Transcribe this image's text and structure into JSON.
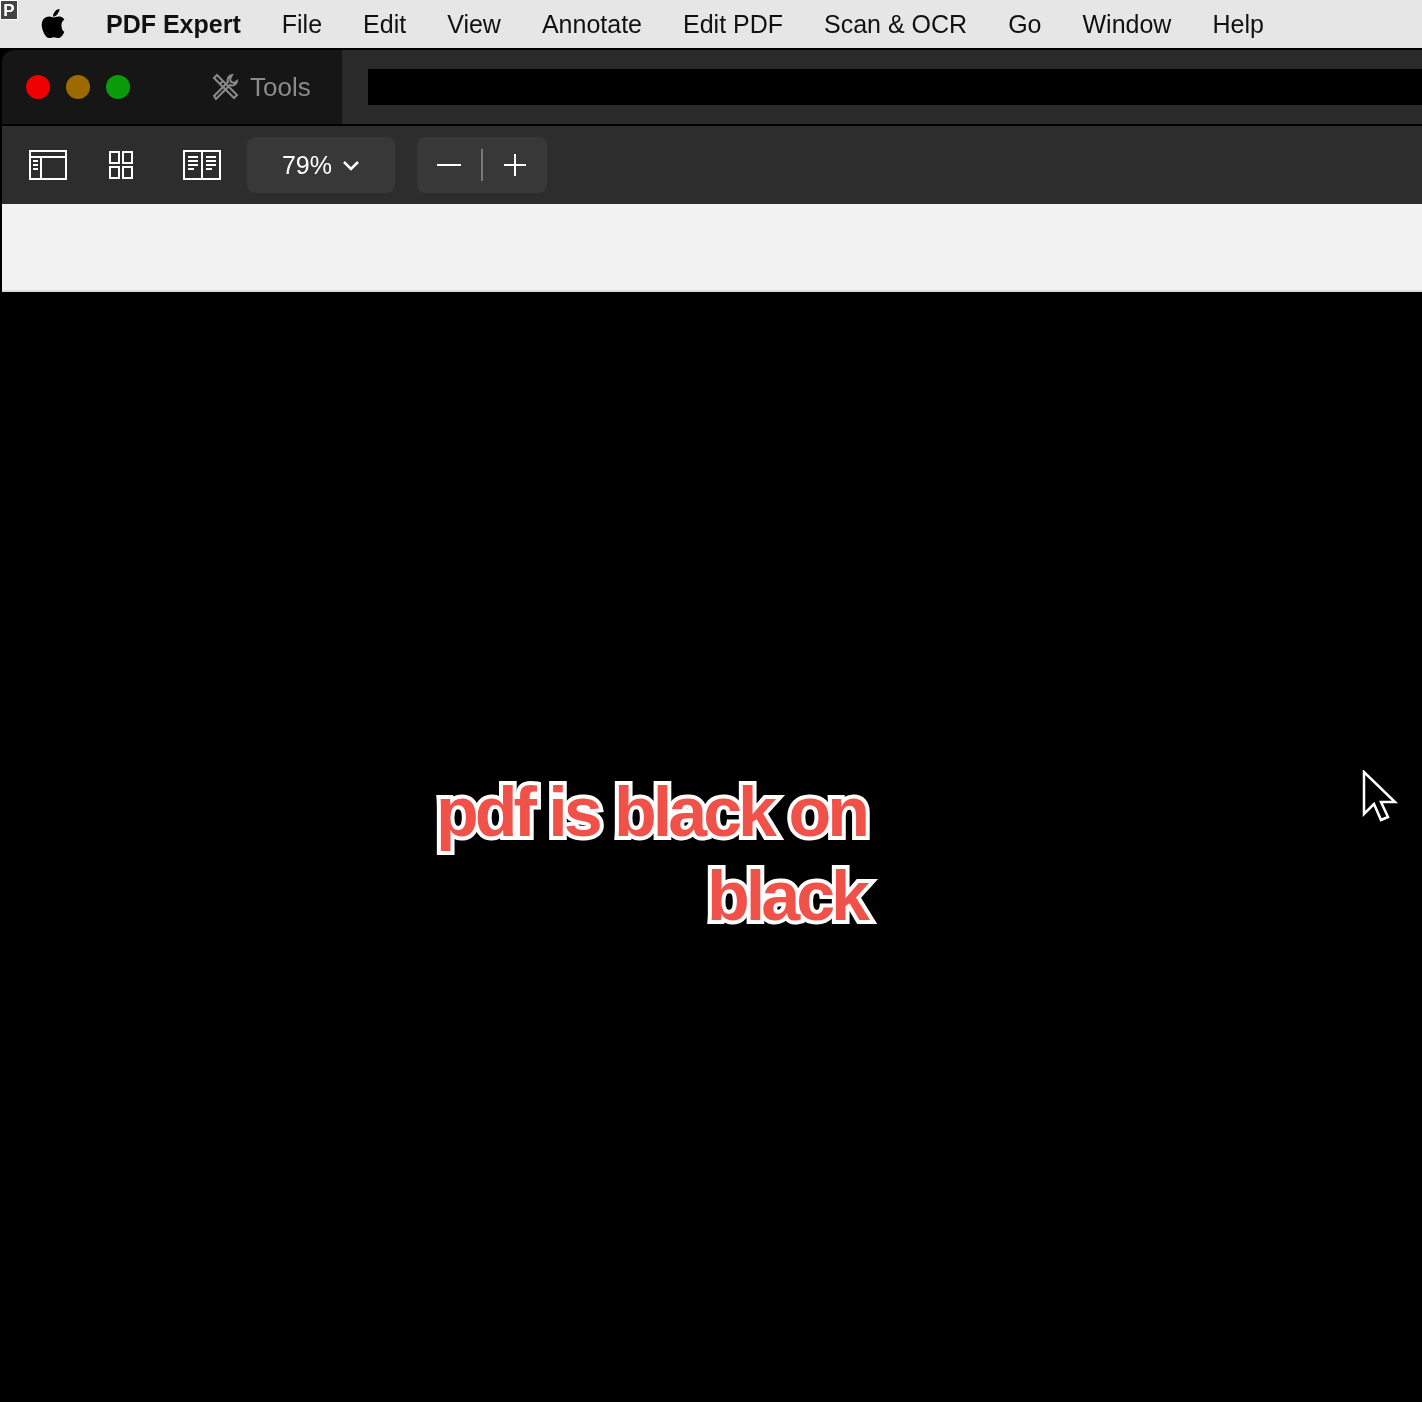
{
  "menu_bar": {
    "app_name": "PDF Expert",
    "items": [
      "File",
      "Edit",
      "View",
      "Annotate",
      "Edit PDF",
      "Scan & OCR",
      "Go",
      "Window",
      "Help"
    ]
  },
  "app_badge": "P",
  "tab_bar": {
    "tools_label": "Tools"
  },
  "toolbar": {
    "zoom": "79%"
  },
  "caption": [
    "pdf is black on",
    "black"
  ]
}
